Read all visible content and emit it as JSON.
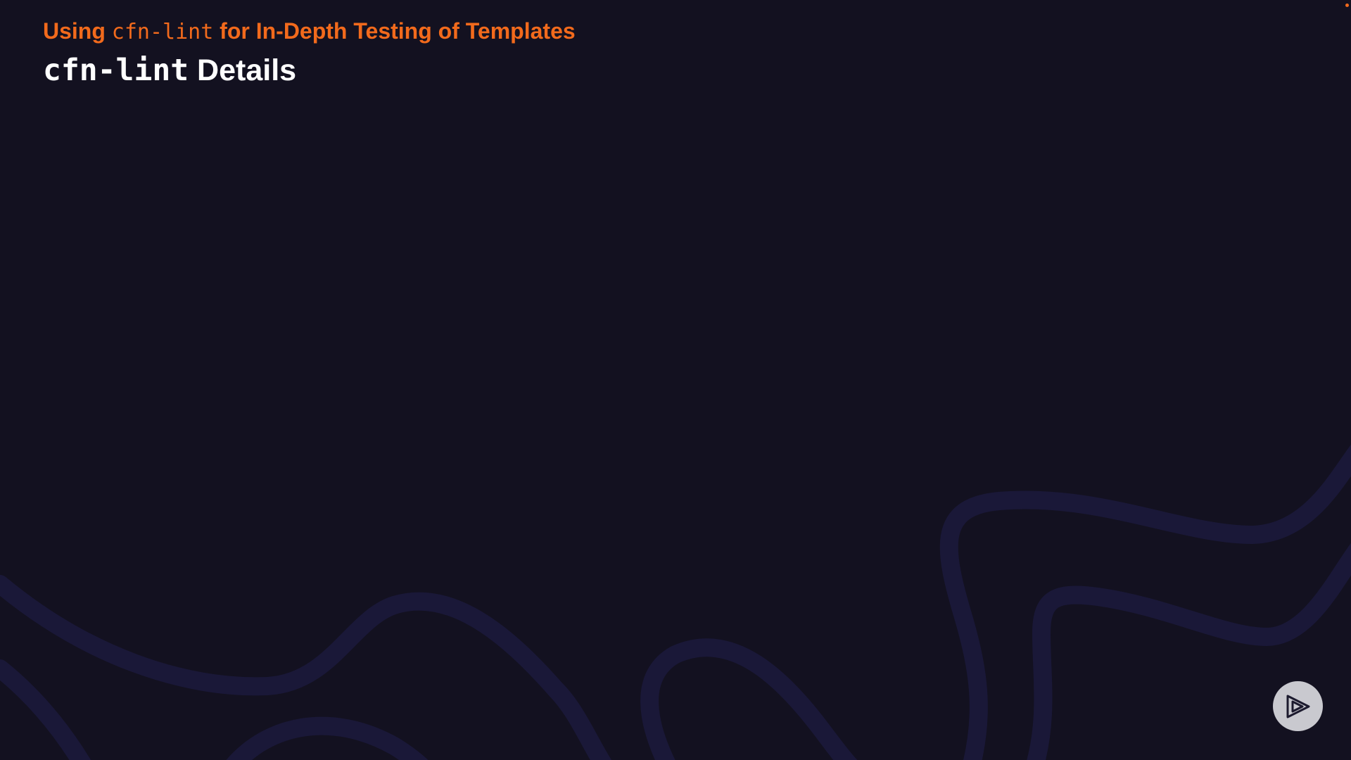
{
  "slide": {
    "subtitle_prefix": "Using ",
    "subtitle_code": "cfn-lint",
    "subtitle_suffix": " for In-Depth Testing of Templates",
    "title_code": "cfn-lint",
    "title_suffix": " Details"
  },
  "player": {
    "play_icon": "play-icon"
  },
  "colors": {
    "background": "#131120",
    "accent": "#f26a1c",
    "title": "#ffffff",
    "wave": "#1a1838",
    "play_button_bg": "#c9c9cf"
  }
}
